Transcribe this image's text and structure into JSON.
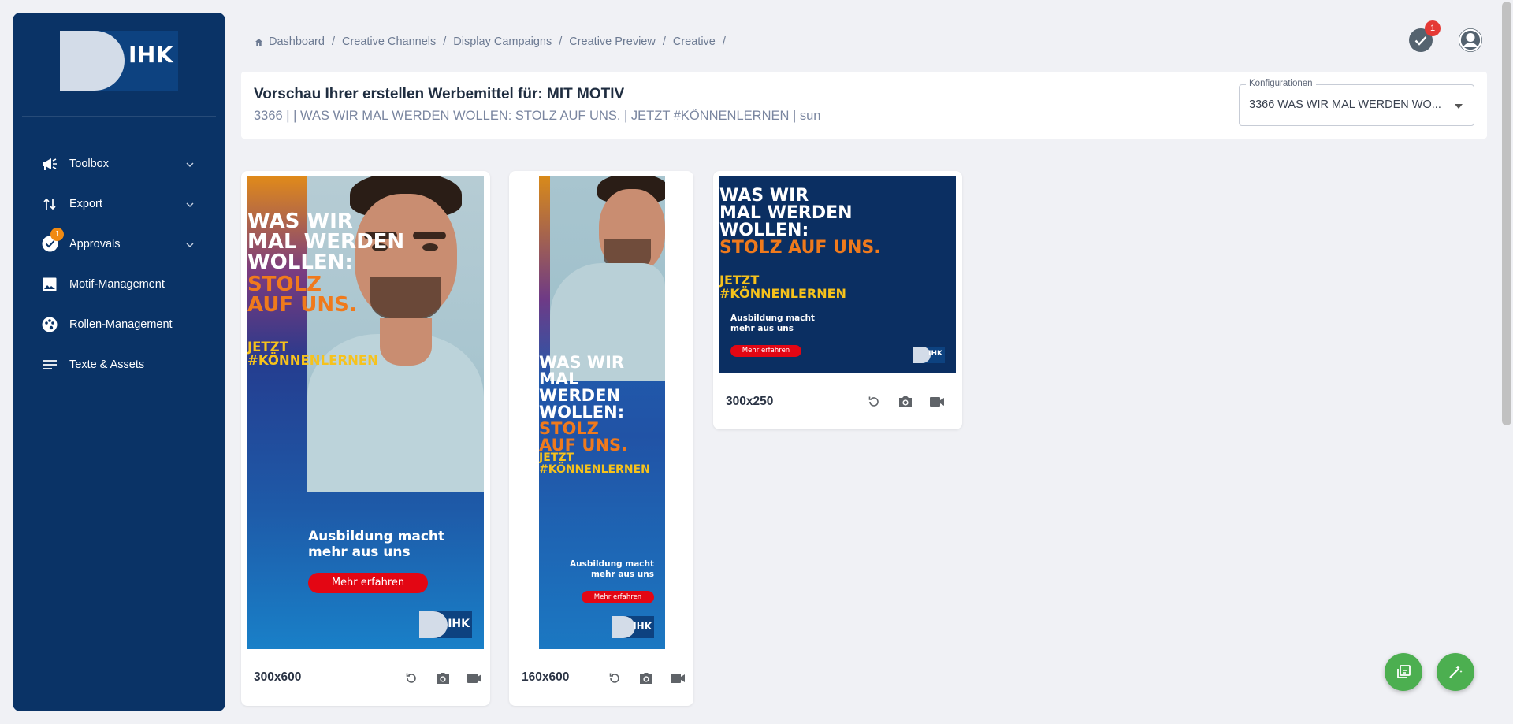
{
  "sidebar": {
    "logo_text": "IHK",
    "items": [
      {
        "label": "Toolbox",
        "icon": "megaphone-icon",
        "chevron": true
      },
      {
        "label": "Export",
        "icon": "sort-arrows-icon",
        "chevron": true
      },
      {
        "label": "Approvals",
        "icon": "check-circle-icon",
        "chevron": true,
        "badge": "1"
      },
      {
        "label": "Motif-Management",
        "icon": "image-icon",
        "chevron": false
      },
      {
        "label": "Rollen-Management",
        "icon": "palette-icon",
        "chevron": false
      },
      {
        "label": "Texte & Assets",
        "icon": "list-icon",
        "chevron": false
      }
    ]
  },
  "breadcrumb": {
    "items": [
      "Dashboard",
      "Creative Channels",
      "Display Campaigns",
      "Creative Preview",
      "Creative"
    ],
    "trailing_sep": "/"
  },
  "topbar": {
    "approvals_badge": "1"
  },
  "header": {
    "title": "Vorschau Ihrer erstellen Werbemittel für: MIT MOTIV",
    "subtitle": "3366 | | WAS WIR MAL WERDEN WOLLEN: STOLZ AUF UNS. | JETZT #KÖNNENLERNEN | sun",
    "config_label": "Konfigurationen",
    "config_value": "3366 WAS WIR MAL WERDEN WO..."
  },
  "ad_copy": {
    "headline_1": "WAS WIR",
    "headline_2": "MAL WERDEN",
    "headline_3": "WOLLEN:",
    "accent_1": "STOLZ",
    "accent_2": "AUF UNS.",
    "accent_combined": "STOLZ AUF UNS.",
    "tag_1": "JETZT",
    "tag_2": "#KÖNNENLERNEN",
    "sub_1": "Ausbildung macht",
    "sub_2": "mehr aus uns",
    "cta": "Mehr erfahren",
    "logo": "IHK"
  },
  "cards": [
    {
      "size": "300x600"
    },
    {
      "size": "160x600"
    },
    {
      "size": "300x250"
    }
  ],
  "colors": {
    "sidebar": "#0a3366",
    "accent_orange": "#f07a1c",
    "accent_yellow": "#f6c21c",
    "cta_red": "#e30613",
    "fab_green": "#4caf50"
  }
}
